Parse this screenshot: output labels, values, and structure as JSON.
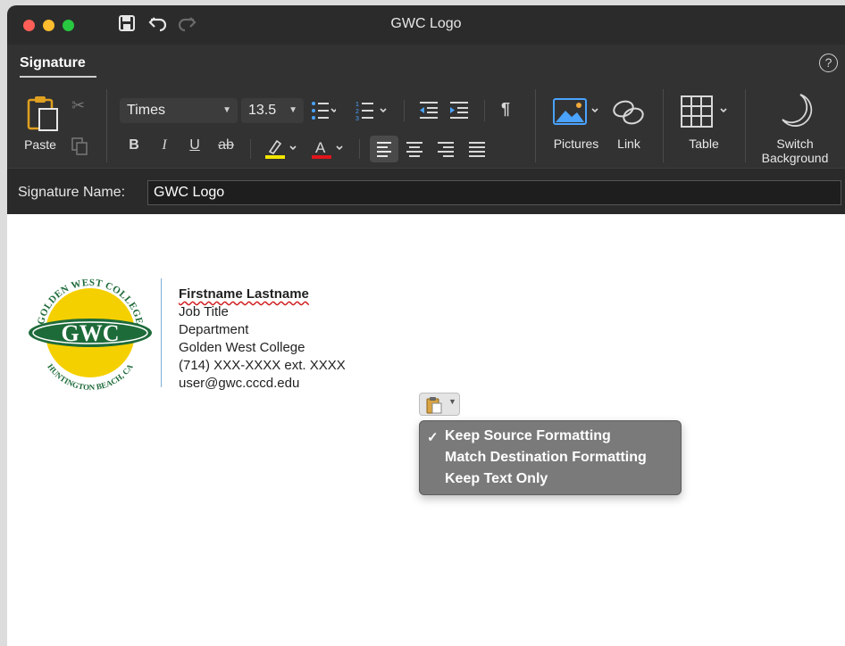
{
  "window": {
    "title": "GWC Logo"
  },
  "ribbon": {
    "tab_label": "Signature",
    "paste_label": "Paste",
    "font_name": "Times",
    "font_size": "13.5",
    "pictures_label": "Pictures",
    "link_label": "Link",
    "table_label": "Table",
    "switch_label_line1": "Switch",
    "switch_label_line2": "Background",
    "bold_label": "B",
    "italic_label": "I",
    "underline_label": "U",
    "strike_label": "ab",
    "font_color_label": "A",
    "pilcrow": "¶"
  },
  "signature_name": {
    "label": "Signature Name:",
    "value": "GWC Logo"
  },
  "signature": {
    "logo_text": "GWC",
    "logo_top_text": "GOLDEN WEST COLLEGE",
    "logo_bottom_text": "HUNTINGTON BEACH, CA",
    "name": "Firstname Lastname",
    "title": "Job Title",
    "department": "Department",
    "college": "Golden West College",
    "phone": "(714) XXX-XXXX ext. XXXX",
    "email": "user@gwc.cccd.edu"
  },
  "paste_menu": {
    "items": [
      {
        "label": "Keep Source Formatting",
        "checked": true
      },
      {
        "label": "Match Destination Formatting",
        "checked": false
      },
      {
        "label": "Keep Text Only",
        "checked": false
      }
    ]
  },
  "colors": {
    "highlight_color": "#f2e600",
    "font_color": "#e0161b",
    "logo_green": "#1e6b3a",
    "logo_yellow": "#f5d000"
  }
}
